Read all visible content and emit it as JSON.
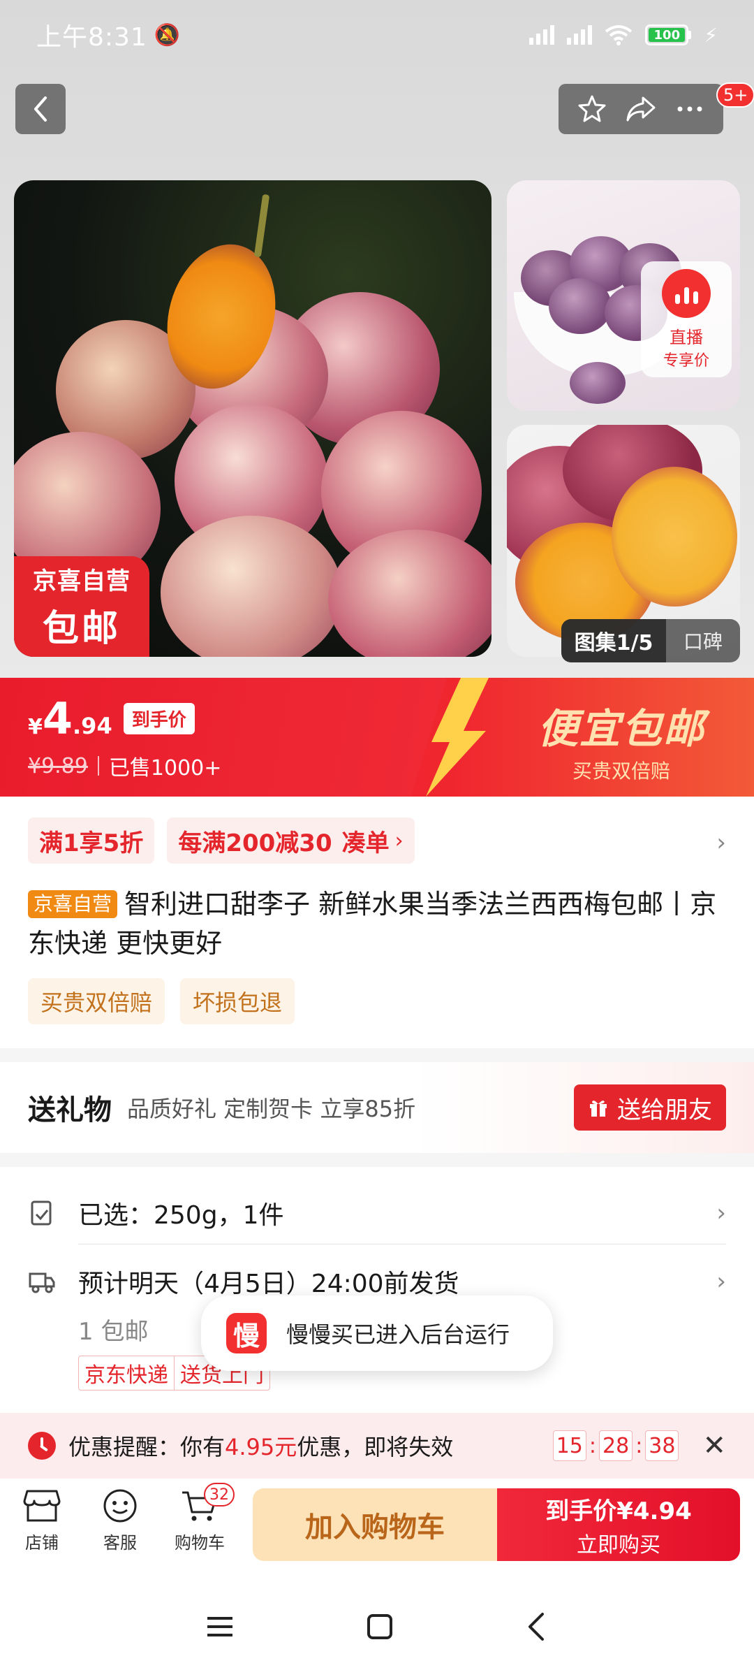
{
  "status_bar": {
    "time": "上午8:31",
    "battery": "100"
  },
  "top_nav": {
    "message_badge": "5+"
  },
  "gallery": {
    "self_tag_line1": "京喜自营",
    "self_tag_line2": "包邮",
    "live_line1": "直播",
    "live_line2": "专享价",
    "gallery_counter": "图集1/5",
    "reviews_tab": "口碑"
  },
  "price": {
    "currency": "¥",
    "integer": "4",
    "decimal": ".94",
    "label": "到手价",
    "original": "¥9.89",
    "sold": "已售1000+",
    "promo_title": "便宜包邮",
    "promo_sub": "买贵双倍赔"
  },
  "coupons": [
    {
      "label": "满1享5折"
    },
    {
      "label": "每满200减30",
      "action": "凑单"
    }
  ],
  "product": {
    "tag": "京喜自营",
    "title": "智利进口甜李子 新鲜水果当季法兰西西梅包邮丨京东快递 更快更好",
    "services": [
      "买贵双倍赔",
      "坏损包退"
    ]
  },
  "gift": {
    "heading": "送礼物",
    "desc": "品质好礼 定制贺卡 立享85折",
    "button": "送给朋友"
  },
  "spec": {
    "selected": "已选：250g，1件",
    "delivery": "预计明天（4月5日）24:00前发货",
    "shipping_sub": "1 包邮",
    "ship_tags": [
      "京东快递",
      "送货上门"
    ]
  },
  "toast": {
    "logo": "慢",
    "message": "慢慢买已进入后台运行"
  },
  "reminder": {
    "prefix": "优惠提醒：你有",
    "amount": "4.95元",
    "suffix": "优惠，即将失效",
    "hh": "15",
    "mm": "28",
    "ss": "38"
  },
  "bottom_bar": {
    "store": "店铺",
    "service": "客服",
    "cart": "购物车",
    "cart_count": "32",
    "add_to_cart": "加入购物车",
    "buy_label": "到手价",
    "buy_price": "¥4.94",
    "buy_action": "立即购买"
  },
  "colors": {
    "brand_red": "#e4262c",
    "promo_gold": "#ffe2b0",
    "cart_bg": "#fde2b8"
  }
}
